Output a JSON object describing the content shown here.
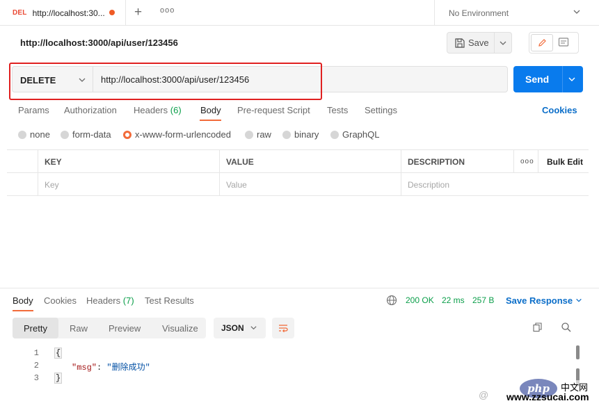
{
  "tabbar": {
    "tab": {
      "method": "DEL",
      "url": "http://localhost:30..."
    },
    "more": "ooo",
    "environment": "No Environment"
  },
  "header": {
    "title": "http://localhost:3000/api/user/123456",
    "save_label": "Save"
  },
  "request": {
    "method": "DELETE",
    "url": "http://localhost:3000/api/user/123456",
    "send_label": "Send"
  },
  "request_tabs": [
    {
      "label": "Params"
    },
    {
      "label": "Authorization"
    },
    {
      "label": "Headers",
      "count": "(6)"
    },
    {
      "label": "Body"
    },
    {
      "label": "Pre-request Script"
    },
    {
      "label": "Tests"
    },
    {
      "label": "Settings"
    }
  ],
  "cookies_label": "Cookies",
  "body_types": [
    "none",
    "form-data",
    "x-www-form-urlencoded",
    "raw",
    "binary",
    "GraphQL"
  ],
  "body_type_selected": "x-www-form-urlencoded",
  "kv_table": {
    "headers": [
      "KEY",
      "VALUE",
      "DESCRIPTION"
    ],
    "more": "ooo",
    "bulk_edit": "Bulk Edit",
    "placeholders": [
      "Key",
      "Value",
      "Description"
    ]
  },
  "response": {
    "tabs": [
      {
        "label": "Body"
      },
      {
        "label": "Cookies"
      },
      {
        "label": "Headers",
        "count": "(7)"
      },
      {
        "label": "Test Results"
      }
    ],
    "status": "200 OK",
    "time": "22 ms",
    "size": "257 B",
    "save_response": "Save Response",
    "formats": [
      "Pretty",
      "Raw",
      "Preview",
      "Visualize"
    ],
    "language": "JSON",
    "lines": [
      {
        "num": "1",
        "text": "{"
      },
      {
        "num": "2",
        "key": "\"msg\"",
        "colon": ": ",
        "value": "\"删除成功\""
      },
      {
        "num": "3",
        "text": "}"
      }
    ]
  },
  "watermark": {
    "logo": "php",
    "cn": "中文网",
    "at": "@",
    "url": "www.zzsucai.com"
  },
  "colors": {
    "accent": "#f26b3a",
    "send": "#097bed",
    "link": "#0b6ec9",
    "status_ok": "#0a9e49",
    "highlight": "#e02020"
  }
}
